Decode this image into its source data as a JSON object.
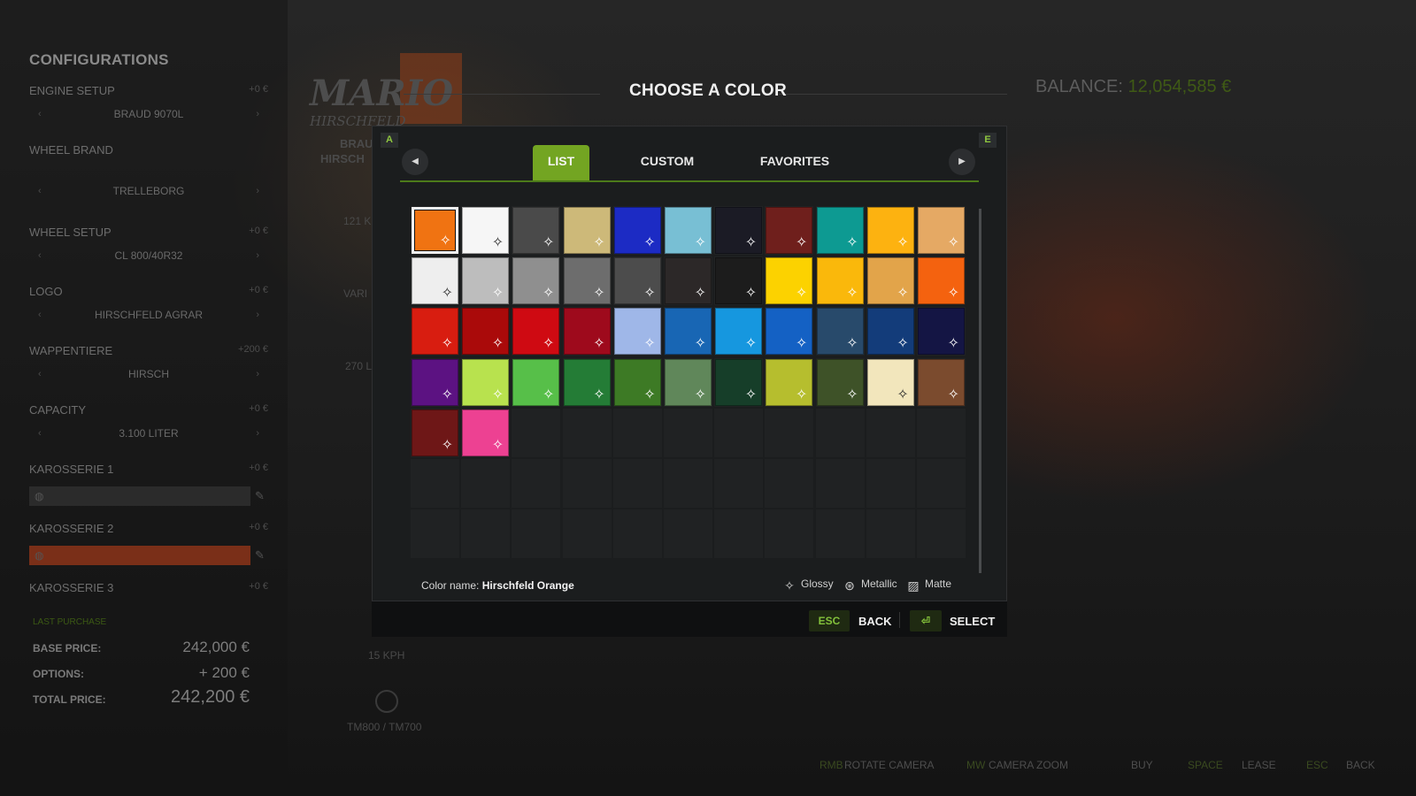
{
  "background": {
    "config_title": "CONFIGURATIONS",
    "sections": [
      {
        "label": "ENGINE SETUP",
        "price": "+0 €",
        "value": "BRAUD 9070L"
      },
      {
        "label": "WHEEL BRAND",
        "price": "",
        "value": "TRELLEBORG"
      },
      {
        "label": "WHEEL SETUP",
        "price": "+0 €",
        "value": "CL 800/40R32"
      },
      {
        "label": "LOGO",
        "price": "+0 €",
        "value": "HIRSCHFELD AGRAR"
      },
      {
        "label": "WAPPENTIERE",
        "price": "+200 €",
        "value": "HIRSCH"
      },
      {
        "label": "CAPACITY",
        "price": "+0 €",
        "value": "3.100 LITER"
      },
      {
        "label": "KAROSSERIE 1",
        "price": "+0 €",
        "value": ""
      },
      {
        "label": "KAROSSERIE 2",
        "price": "+0 €",
        "value": ""
      },
      {
        "label": "KAROSSERIE 3",
        "price": "+0 €",
        "value": ""
      }
    ],
    "config_label": "LAST PURCHASE",
    "prices": [
      {
        "label": "BASE PRICE:",
        "value": "242,000 €"
      },
      {
        "label": "OPTIONS:",
        "value": "+ 200 €"
      },
      {
        "label": "TOTAL PRICE:",
        "value": "242,200 €"
      }
    ],
    "brand_big": "MARIO",
    "brand_small": "HIRSCHFELD",
    "brand_sub1": "BRAU",
    "brand_sub2": "HIRSCH",
    "stat1": "121 K",
    "stat2": "VARI",
    "stat3": "270 L",
    "stat4": "15 KPH",
    "model": "TM800 / TM700",
    "balance_label": "BALANCE:",
    "balance_value": "12,054,585 €",
    "bottom": {
      "rotate_key": "RMB",
      "rotate": "ROTATE CAMERA",
      "zoom_key": "MW",
      "zoom": "CAMERA ZOOM",
      "buy": "BUY",
      "lease_key": "SPACE",
      "lease": "LEASE",
      "back_key": "ESC",
      "back": "BACK"
    }
  },
  "dialog": {
    "title": "CHOOSE A COLOR",
    "key_prev": "A",
    "key_next": "E",
    "tabs": [
      "LIST",
      "CUSTOM",
      "FAVORITES"
    ],
    "active_tab": "LIST",
    "color_name_label": "Color name:",
    "color_name": "Hirschfeld Orange",
    "legend": {
      "glossy": "Glossy",
      "metallic": "Metallic",
      "matte": "Matte"
    },
    "footer": {
      "esc_key": "ESC",
      "back": "BACK",
      "select_key": "⏎",
      "select": "SELECT"
    }
  },
  "colors": [
    [
      "#f07312",
      "#f6f6f6",
      "#4a4a4a",
      "#cdb979",
      "#1c2bc4",
      "#78bfd4",
      "#1b1b25",
      "#6f1f1c",
      "#0d9a92",
      "#fdb210",
      "#e5a964"
    ],
    [
      "#eeeeee",
      "#bdbdbd",
      "#8f8f8f",
      "#6d6d6d",
      "#4c4c4c",
      "#2c2828",
      "#1c1c1c",
      "#fcd200",
      "#fab80b",
      "#e2a44a",
      "#f4620f"
    ],
    [
      "#d81d10",
      "#aa0a0a",
      "#cf0a12",
      "#9e0a1c",
      "#9fb7e8",
      "#1866b4",
      "#1697df",
      "#1461c4",
      "#284a6b",
      "#133c7a",
      "#141544"
    ],
    [
      "#5c1282",
      "#b8e24e",
      "#57bf49",
      "#247c36",
      "#3d7a25",
      "#60875a",
      "#163e29",
      "#b6be2e",
      "#3e5228",
      "#f2e6bc",
      "#7b4b2e"
    ],
    [
      "#6e1717",
      "#ed4192"
    ]
  ],
  "selected_color_index": [
    0,
    0
  ]
}
